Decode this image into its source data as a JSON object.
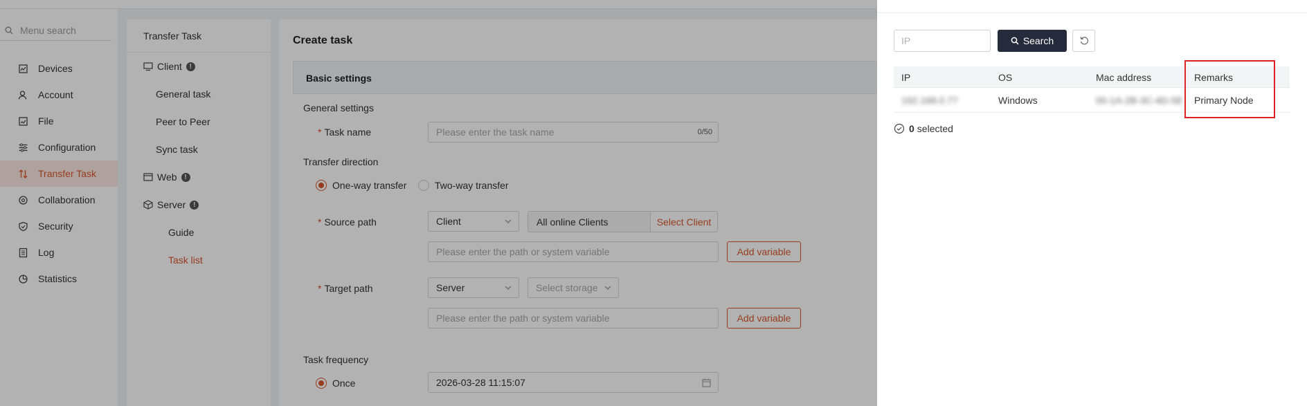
{
  "menu": {
    "search_placeholder": "Menu search",
    "items": [
      {
        "label": "Devices",
        "icon": "devices-icon"
      },
      {
        "label": "Account",
        "icon": "account-icon"
      },
      {
        "label": "File",
        "icon": "file-icon"
      },
      {
        "label": "Configuration",
        "icon": "configuration-icon"
      },
      {
        "label": "Transfer Task",
        "icon": "transfer-icon",
        "active": true
      },
      {
        "label": "Collaboration",
        "icon": "collaboration-icon"
      },
      {
        "label": "Security",
        "icon": "shield-icon"
      },
      {
        "label": "Log",
        "icon": "log-icon"
      },
      {
        "label": "Statistics",
        "icon": "statistics-icon"
      }
    ]
  },
  "submenu": {
    "header": "Transfer Task",
    "client": "Client",
    "general_task": "General task",
    "peer_to_peer": "Peer to Peer",
    "sync_task": "Sync task",
    "web": "Web",
    "server": "Server",
    "guide": "Guide",
    "task_list": "Task list"
  },
  "form": {
    "title": "Create task",
    "basic_settings": "Basic settings",
    "general_settings": "General settings",
    "task_name_label": "Task name",
    "task_name_placeholder": "Please enter the task name",
    "task_name_count": "0/50",
    "transfer_direction": "Transfer direction",
    "one_way": "One-way transfer",
    "two_way": "Two-way transfer",
    "source_path_label": "Source path",
    "source_type": "Client",
    "all_online_clients": "All online Clients",
    "select_client": "Select Client",
    "path_placeholder": "Please enter the path or system variable",
    "add_variable": "Add variable",
    "target_path_label": "Target path",
    "target_type": "Server",
    "select_storage": "Select storage",
    "task_frequency": "Task frequency",
    "once": "Once",
    "datetime": "2026-03-28 11:15:07"
  },
  "drawer": {
    "ip_placeholder": "IP",
    "search_label": "Search",
    "columns": [
      "IP",
      "OS",
      "Mac address",
      "Remarks"
    ],
    "row": {
      "ip": "192.168.0.77",
      "os": "Windows",
      "mac": "00-1A-2B-3C-4D-5E",
      "remarks": "Primary Node"
    },
    "selected_count": "0",
    "selected_label": "selected"
  },
  "colors": {
    "accent": "#d9572b",
    "dark_button": "#252b3a",
    "highlight": "#e01f26"
  }
}
